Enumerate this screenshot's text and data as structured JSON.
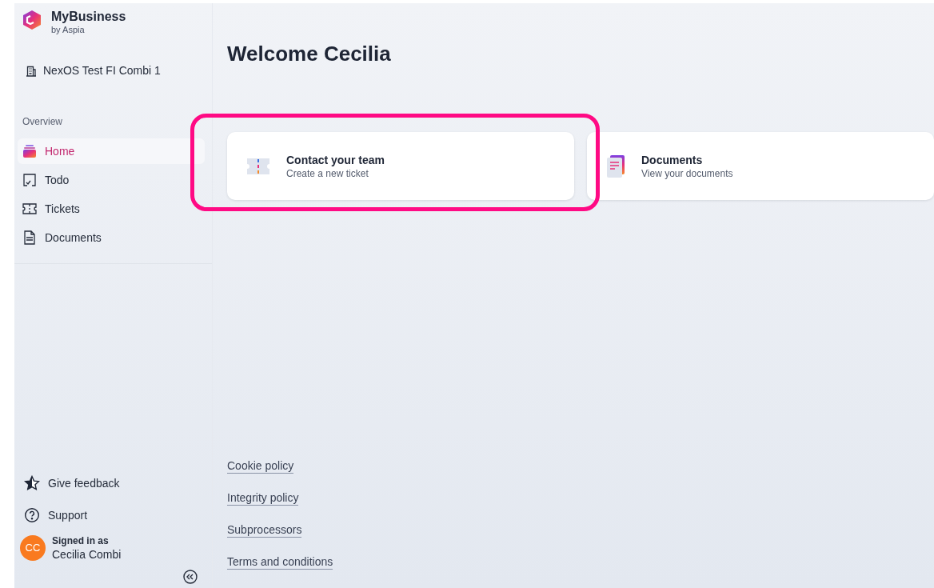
{
  "brand": {
    "name": "MyBusiness",
    "byline": "by Aspia"
  },
  "company": "NexOS Test FI Combi 1",
  "nav": {
    "heading": "Overview",
    "items": [
      {
        "label": "Home",
        "kind": "home",
        "selected": true
      },
      {
        "label": "Todo",
        "kind": "todo",
        "selected": false
      },
      {
        "label": "Tickets",
        "kind": "tickets",
        "selected": false
      },
      {
        "label": "Documents",
        "kind": "documents",
        "selected": false
      }
    ]
  },
  "sidebar_footer": [
    {
      "label": "Give feedback",
      "kind": "feedback"
    },
    {
      "label": "Support",
      "kind": "support"
    }
  ],
  "user": {
    "initials": "CC",
    "caption": "Signed in as",
    "name": "Cecilia Combi"
  },
  "title": "Welcome Cecilia",
  "cards": [
    {
      "title": "Contact your team",
      "subtitle": "Create a new ticket",
      "kind": "ticket",
      "highlighted": true
    },
    {
      "title": "Documents",
      "subtitle": "View your documents",
      "kind": "document",
      "highlighted": false
    }
  ],
  "footer_links": [
    "Cookie policy",
    "Integrity policy",
    "Subprocessors",
    "Terms and conditions"
  ]
}
